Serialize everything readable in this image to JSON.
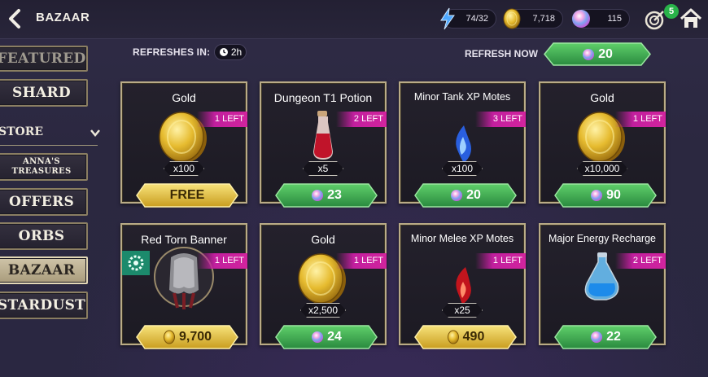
{
  "header": {
    "title": "BAZAAR"
  },
  "resources": [
    {
      "name": "energy",
      "value": "74/32",
      "icon": "energy-bolt-icon"
    },
    {
      "name": "gold",
      "value": "7,718",
      "icon": "gold-coin-icon"
    },
    {
      "name": "crystals",
      "value": "115",
      "icon": "crystal-orb-icon"
    }
  ],
  "notification": {
    "count": "5"
  },
  "sidebar": {
    "items": [
      {
        "label": "FEATURED"
      },
      {
        "label": "SHARD"
      },
      {
        "label": "ANNA'S TREASURES"
      },
      {
        "label": "OFFERS"
      },
      {
        "label": "ORBS"
      },
      {
        "label": "BAZAAR"
      },
      {
        "label": "STARDUST"
      }
    ],
    "store_label": "STORE"
  },
  "refresh": {
    "in_label": "REFRESHES IN:",
    "timer": "2h",
    "now_label": "REFRESH NOW",
    "cost": "20"
  },
  "cards": [
    {
      "name": "Gold",
      "left": "1 LEFT",
      "qty": "x100",
      "price": "FREE",
      "currency": "free"
    },
    {
      "name": "Dungeon T1 Potion",
      "left": "2 LEFT",
      "qty": "x5",
      "price": "23",
      "currency": "crystal"
    },
    {
      "name": "Minor Tank XP Motes",
      "left": "3 LEFT",
      "qty": "x100",
      "price": "20",
      "currency": "crystal"
    },
    {
      "name": "Gold",
      "left": "1 LEFT",
      "qty": "x10,000",
      "price": "90",
      "currency": "crystal"
    },
    {
      "name": "Red Torn Banner",
      "left": "1 LEFT",
      "qty": "",
      "price": "9,700",
      "currency": "gold"
    },
    {
      "name": "Gold",
      "left": "1 LEFT",
      "qty": "x2,500",
      "price": "24",
      "currency": "crystal"
    },
    {
      "name": "Minor Melee XP Motes",
      "left": "1 LEFT",
      "qty": "x25",
      "price": "490",
      "currency": "gold"
    },
    {
      "name": "Major Energy Recharge",
      "left": "2 LEFT",
      "qty": "",
      "price": "22",
      "currency": "crystal"
    }
  ],
  "colors": {
    "green": "#2f9a4a",
    "gold": "#d8b534",
    "magenta": "#c21f9e"
  }
}
